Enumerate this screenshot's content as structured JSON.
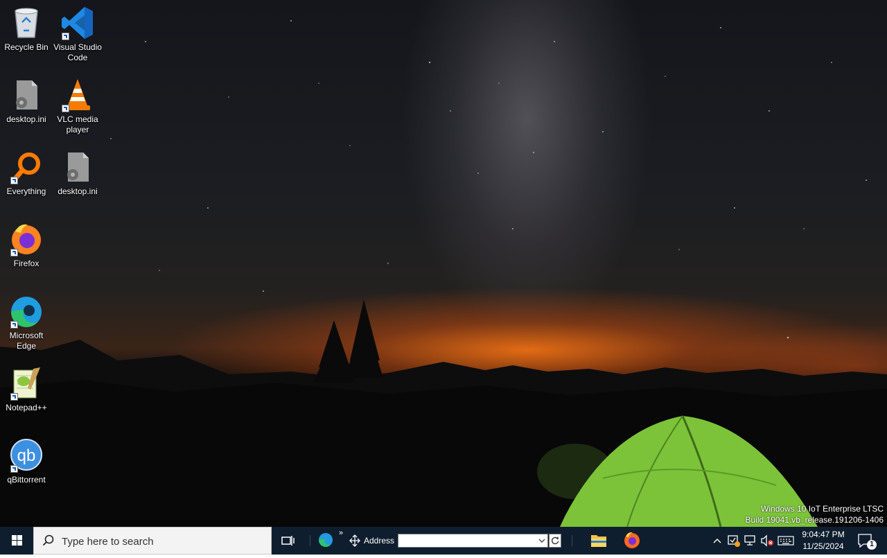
{
  "desktop": {
    "icons": [
      {
        "label": "Recycle Bin",
        "icon": "recycle-bin-icon"
      },
      {
        "label": "Visual Studio Code",
        "icon": "vscode-icon"
      },
      {
        "label": "desktop.ini",
        "icon": "settings-file-icon"
      },
      {
        "label": "VLC media player",
        "icon": "vlc-cone-icon"
      },
      {
        "label": "Everything",
        "icon": "everything-search-icon"
      },
      {
        "label": "desktop.ini",
        "icon": "settings-file-icon"
      },
      {
        "label": "Firefox",
        "icon": "firefox-icon"
      },
      {
        "label": "Microsoft Edge",
        "icon": "edge-icon"
      },
      {
        "label": "Notepad++",
        "icon": "notepadpp-icon"
      },
      {
        "label": "qBittorrent",
        "icon": "qbittorrent-icon"
      }
    ]
  },
  "watermark": {
    "line1": "Windows 10 IoT Enterprise LTSC",
    "line2": "Build 19041.vb_release.191206-1406"
  },
  "taskbar": {
    "search_placeholder": "Type here to search",
    "address_label": "Address",
    "address_value": "",
    "overflow_chevron": "»",
    "clock_time": "9:04:47 PM",
    "clock_date": "11/25/2024",
    "notification_count": "1",
    "colors": {
      "background": "#0f1e2e",
      "search_bg": "#f3f3f3"
    }
  }
}
